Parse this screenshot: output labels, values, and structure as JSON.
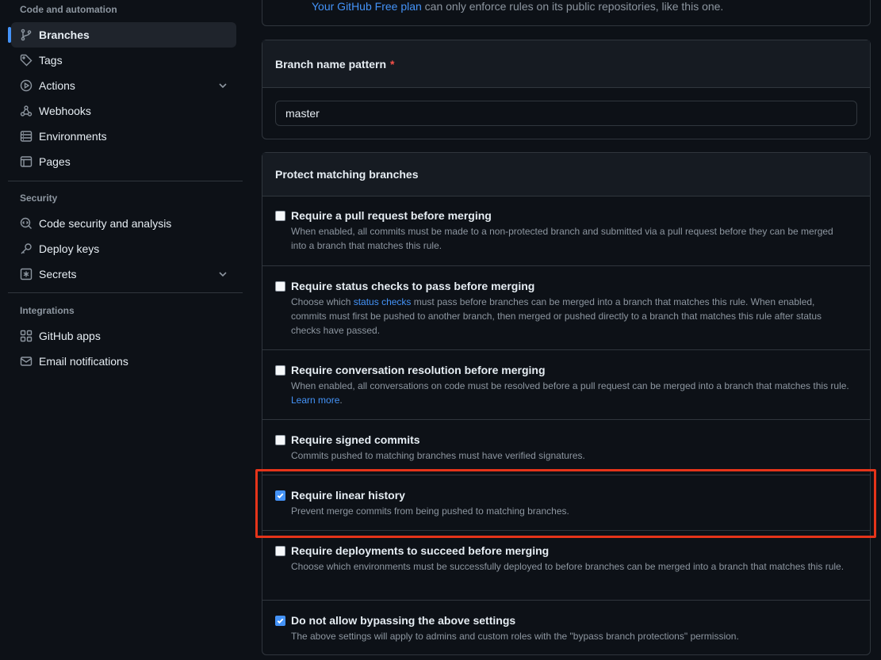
{
  "sidebar": {
    "code_automation_title": "Code and automation",
    "security_title": "Security",
    "integrations_title": "Integrations",
    "items": {
      "branches": "Branches",
      "tags": "Tags",
      "actions": "Actions",
      "webhooks": "Webhooks",
      "environments": "Environments",
      "pages": "Pages",
      "code_security": "Code security and analysis",
      "deploy_keys": "Deploy keys",
      "secrets": "Secrets",
      "github_apps": "GitHub apps",
      "email_notifications": "Email notifications"
    }
  },
  "notice": {
    "link": "Your GitHub Free plan",
    "text": " can only enforce rules on its public repositories, like this one."
  },
  "pattern": {
    "label": "Branch name pattern",
    "required_mark": "*",
    "value": "master"
  },
  "protect": {
    "title": "Protect matching branches",
    "rules": [
      {
        "title": "Require a pull request before merging",
        "desc": "When enabled, all commits must be made to a non-protected branch and submitted via a pull request before they can be merged into a branch that matches this rule.",
        "checked": false
      },
      {
        "title": "Require status checks to pass before merging",
        "desc_before": "Choose which ",
        "desc_link": "status checks",
        "desc_after": " must pass before branches can be merged into a branch that matches this rule. When enabled, commits must first be pushed to another branch, then merged or pushed directly to a branch that matches this rule after status checks have passed.",
        "checked": false
      },
      {
        "title": "Require conversation resolution before merging",
        "desc_before": "When enabled, all conversations on code must be resolved before a pull request can be merged into a branch that matches this rule. ",
        "desc_link": "Learn more",
        "desc_after": ".",
        "checked": false
      },
      {
        "title": "Require signed commits",
        "desc": "Commits pushed to matching branches must have verified signatures.",
        "checked": false
      },
      {
        "title": "Require linear history",
        "desc": "Prevent merge commits from being pushed to matching branches.",
        "checked": true
      },
      {
        "title": "Require deployments to succeed before merging",
        "desc": "Choose which environments must be successfully deployed to before branches can be merged into a branch that matches this rule.",
        "checked": false
      },
      {
        "title": "Do not allow bypassing the above settings",
        "desc": "The above settings will apply to admins and custom roles with the \"bypass branch protections\" permission.",
        "checked": true
      }
    ]
  },
  "colors": {
    "accent": "#4493f8",
    "highlight": "#e5341a",
    "background": "#0d1117"
  }
}
